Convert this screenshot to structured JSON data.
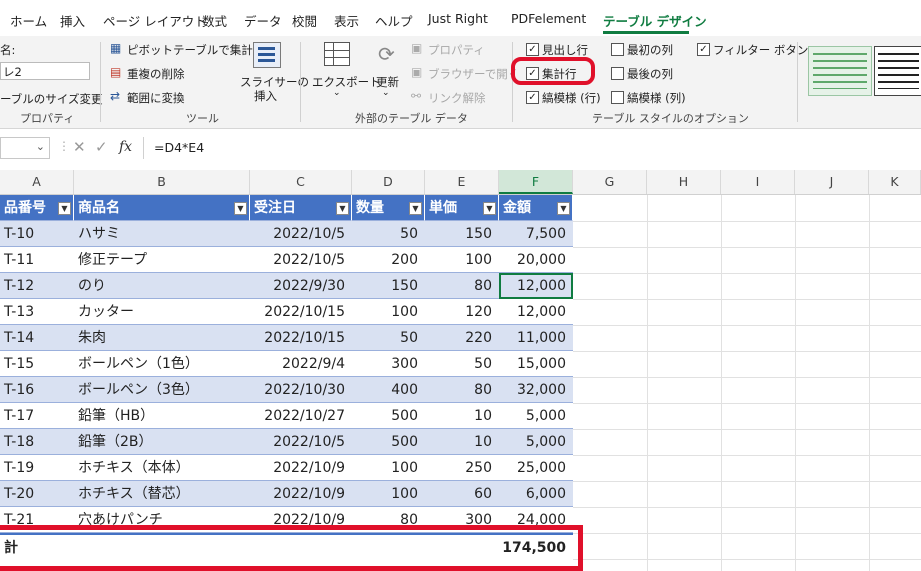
{
  "tabs": [
    "ホーム",
    "挿入",
    "ページ レイアウト",
    "数式",
    "データ",
    "校閲",
    "表示",
    "ヘルプ",
    "Just Right",
    "PDFelement",
    "テーブル デザイン"
  ],
  "properties": {
    "name_label": "名:",
    "name_value": "レ2",
    "resize_label": "ーブルのサイズ変更",
    "group_label": "プロパティ"
  },
  "tools": {
    "pivot": "ピボットテーブルで集計",
    "dedupe": "重複の削除",
    "convert": "範囲に変換",
    "slicer_line1": "スライサーの",
    "slicer_line2": "挿入",
    "group_label": "ツール"
  },
  "external": {
    "export": "エクスポート",
    "refresh": "更新",
    "properties": "プロパティ",
    "browser": "ブラウザーで開く",
    "unlink": "リンク解除",
    "group_label": "外部のテーブル データ"
  },
  "style_options": {
    "header_row": "見出し行",
    "total_row": "集計行",
    "banded_rows": "縞模様 (行)",
    "first_col": "最初の列",
    "last_col": "最後の列",
    "banded_cols": "縞模様 (列)",
    "filter_button": "フィルター ボタン",
    "group_label": "テーブル スタイルのオプション",
    "checked": {
      "header_row": true,
      "total_row": true,
      "banded_rows": true,
      "first_col": false,
      "last_col": false,
      "banded_cols": false,
      "filter_button": true
    }
  },
  "formula_bar": {
    "fx": "fx",
    "formula": "=D4*E4"
  },
  "columns": [
    "A",
    "B",
    "C",
    "D",
    "E",
    "F",
    "G",
    "H",
    "I",
    "J",
    "K"
  ],
  "table": {
    "headers": [
      "品番号",
      "商品名",
      "受注日",
      "数量",
      "単価",
      "金額"
    ],
    "rows": [
      [
        "T-10",
        "ハサミ",
        "2022/10/5",
        "50",
        "150",
        "7,500"
      ],
      [
        "T-11",
        "修正テープ",
        "2022/10/5",
        "200",
        "100",
        "20,000"
      ],
      [
        "T-12",
        "のり",
        "2022/9/30",
        "150",
        "80",
        "12,000"
      ],
      [
        "T-13",
        "カッター",
        "2022/10/15",
        "100",
        "120",
        "12,000"
      ],
      [
        "T-14",
        "朱肉",
        "2022/10/15",
        "50",
        "220",
        "11,000"
      ],
      [
        "T-15",
        "ボールペン（1色）",
        "2022/9/4",
        "300",
        "50",
        "15,000"
      ],
      [
        "T-16",
        "ボールペン（3色）",
        "2022/10/30",
        "400",
        "80",
        "32,000"
      ],
      [
        "T-17",
        "鉛筆（HB）",
        "2022/10/27",
        "500",
        "10",
        "5,000"
      ],
      [
        "T-18",
        "鉛筆（2B）",
        "2022/10/5",
        "500",
        "10",
        "5,000"
      ],
      [
        "T-19",
        "ホチキス（本体）",
        "2022/10/9",
        "100",
        "250",
        "25,000"
      ],
      [
        "T-20",
        "ホチキス（替芯）",
        "2022/10/9",
        "100",
        "60",
        "6,000"
      ],
      [
        "T-21",
        "穴あけパンチ",
        "2022/10/9",
        "80",
        "300",
        "24,000"
      ]
    ],
    "total_label": "計",
    "total_value": "174,500"
  },
  "colors": {
    "accent": "#107c41",
    "table_header": "#4472c4",
    "band": "#d9e1f2",
    "highlight": "#e0102a"
  }
}
